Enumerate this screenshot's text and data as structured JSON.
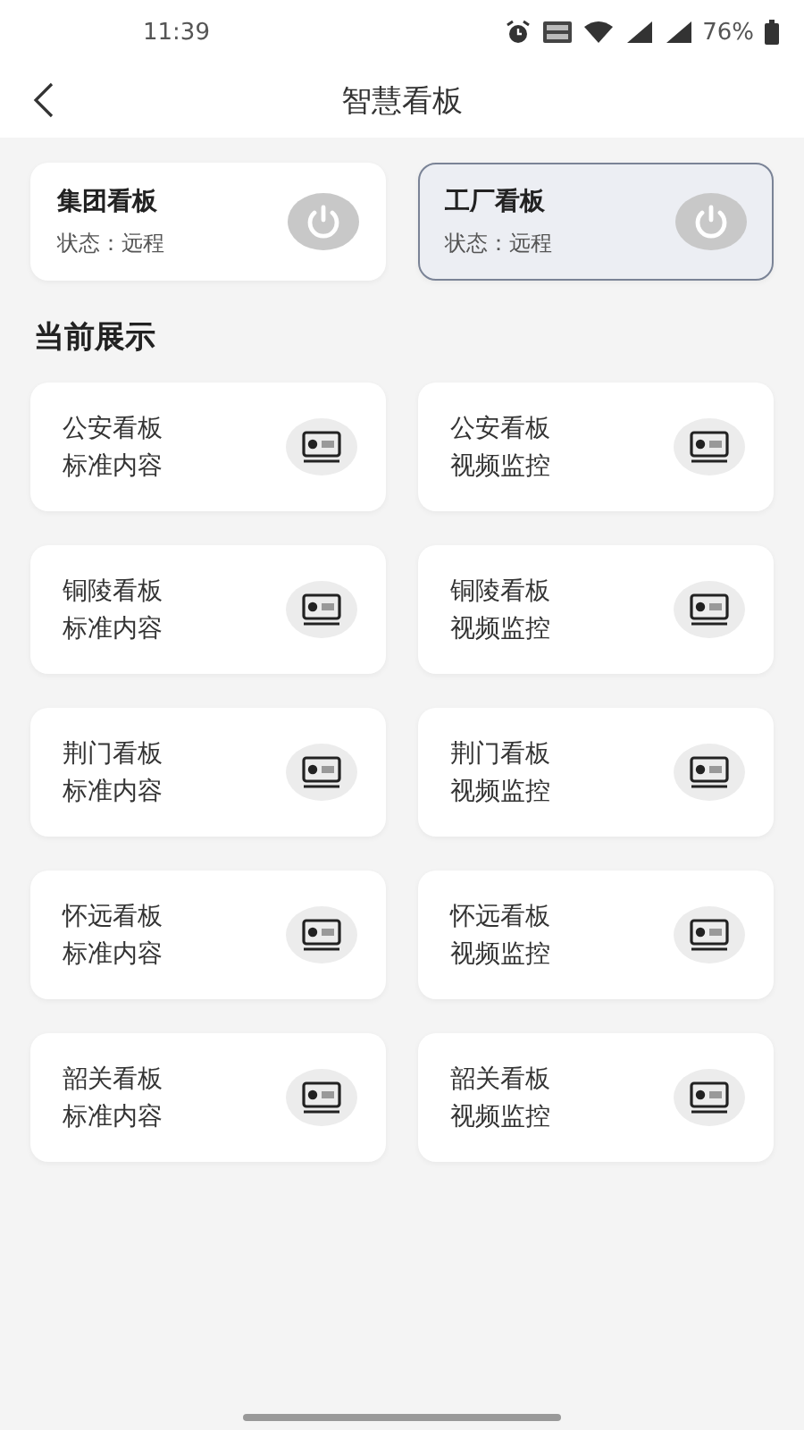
{
  "status_bar": {
    "time": "11:39",
    "battery": "76%"
  },
  "header": {
    "title": "智慧看板"
  },
  "boards": [
    {
      "name": "集团看板",
      "status": "状态：远程",
      "selected": false
    },
    {
      "name": "工厂看板",
      "status": "状态：远程",
      "selected": true
    }
  ],
  "section_title": "当前展示",
  "displays": [
    {
      "line1": "公安看板",
      "line2": "标准内容"
    },
    {
      "line1": "公安看板",
      "line2": "视频监控"
    },
    {
      "line1": "铜陵看板",
      "line2": "标准内容"
    },
    {
      "line1": "铜陵看板",
      "line2": "视频监控"
    },
    {
      "line1": "荆门看板",
      "line2": "标准内容"
    },
    {
      "line1": "荆门看板",
      "line2": "视频监控"
    },
    {
      "line1": "怀远看板",
      "line2": "标准内容"
    },
    {
      "line1": "怀远看板",
      "line2": "视频监控"
    },
    {
      "line1": "韶关看板",
      "line2": "标准内容"
    },
    {
      "line1": "韶关看板",
      "line2": "视频监控"
    }
  ]
}
